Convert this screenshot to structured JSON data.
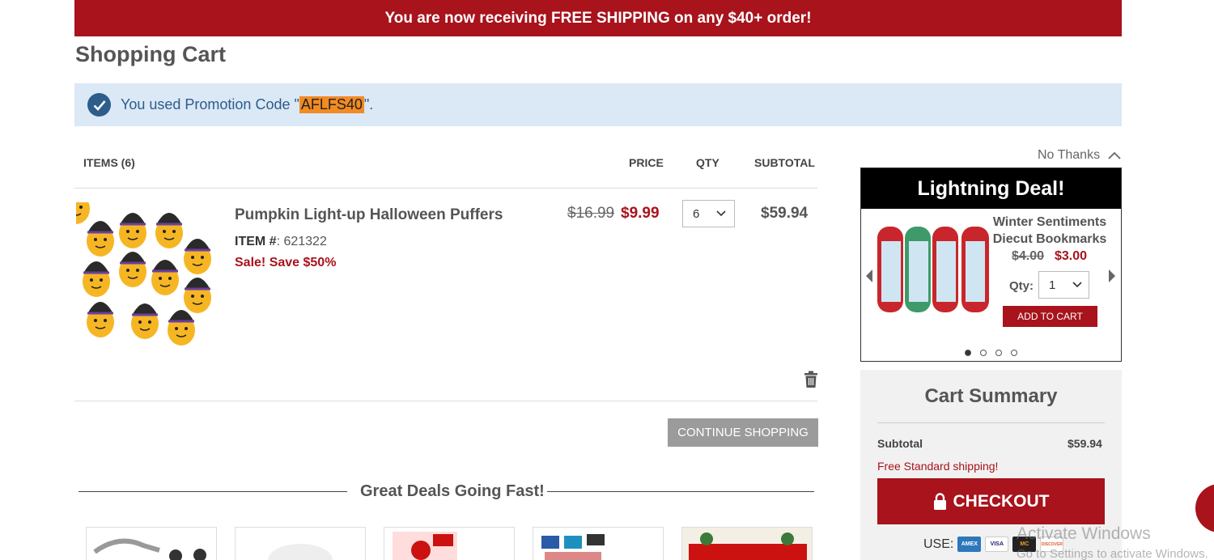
{
  "banner": {
    "text": "You are now receiving FREE SHIPPING on any $40+ order!"
  },
  "page_title": "Shopping Cart",
  "promo": {
    "prefix": "You used Promotion Code \"",
    "code": "AFLFS40",
    "suffix": "\"."
  },
  "cart_header": {
    "items": "ITEMS (6)",
    "price": "PRICE",
    "qty": "QTY",
    "subtotal": "SUBTOTAL"
  },
  "line_item": {
    "name": "Pumpkin Light-up Halloween Puffers",
    "item_label": "ITEM #",
    "item_sep": ": ",
    "item_number": "621322",
    "sale_text": "Sale! Save $50%",
    "original_price": "$16.99",
    "sale_price": "$9.99",
    "qty": "6",
    "subtotal": "$59.94"
  },
  "continue_label": "CONTINUE SHOPPING",
  "deals_title": "Great Deals Going Fast!",
  "upsell": {
    "no_thanks": "No Thanks",
    "title": "Lightning Deal!",
    "product_name_1": "Winter Sentiments",
    "product_name_2": "Diecut Bookmarks",
    "original_price": "$4.00",
    "sale_price": "$3.00",
    "qty_label": "Qty:",
    "qty": "1",
    "add_to_cart": "ADD TO CART",
    "active_slide": 1,
    "slide_count": 4
  },
  "summary": {
    "title": "Cart Summary",
    "subtotal_label": "Subtotal",
    "subtotal_value": "$59.94",
    "shipping_text": "Free Standard shipping!",
    "checkout_label": "CHECKOUT",
    "use_label": "USE:",
    "cards": [
      "AMEX",
      "VISA",
      "MC",
      "DISCOVER"
    ]
  },
  "watermark": {
    "line1": "Activate Windows",
    "line2": "Go to Settings to activate Windows."
  },
  "colors": {
    "brand_red": "#a8131c",
    "promo_bg": "#dbe8f6",
    "promo_code_bg": "#f28b22",
    "button_gray": "#9b9b9b"
  }
}
